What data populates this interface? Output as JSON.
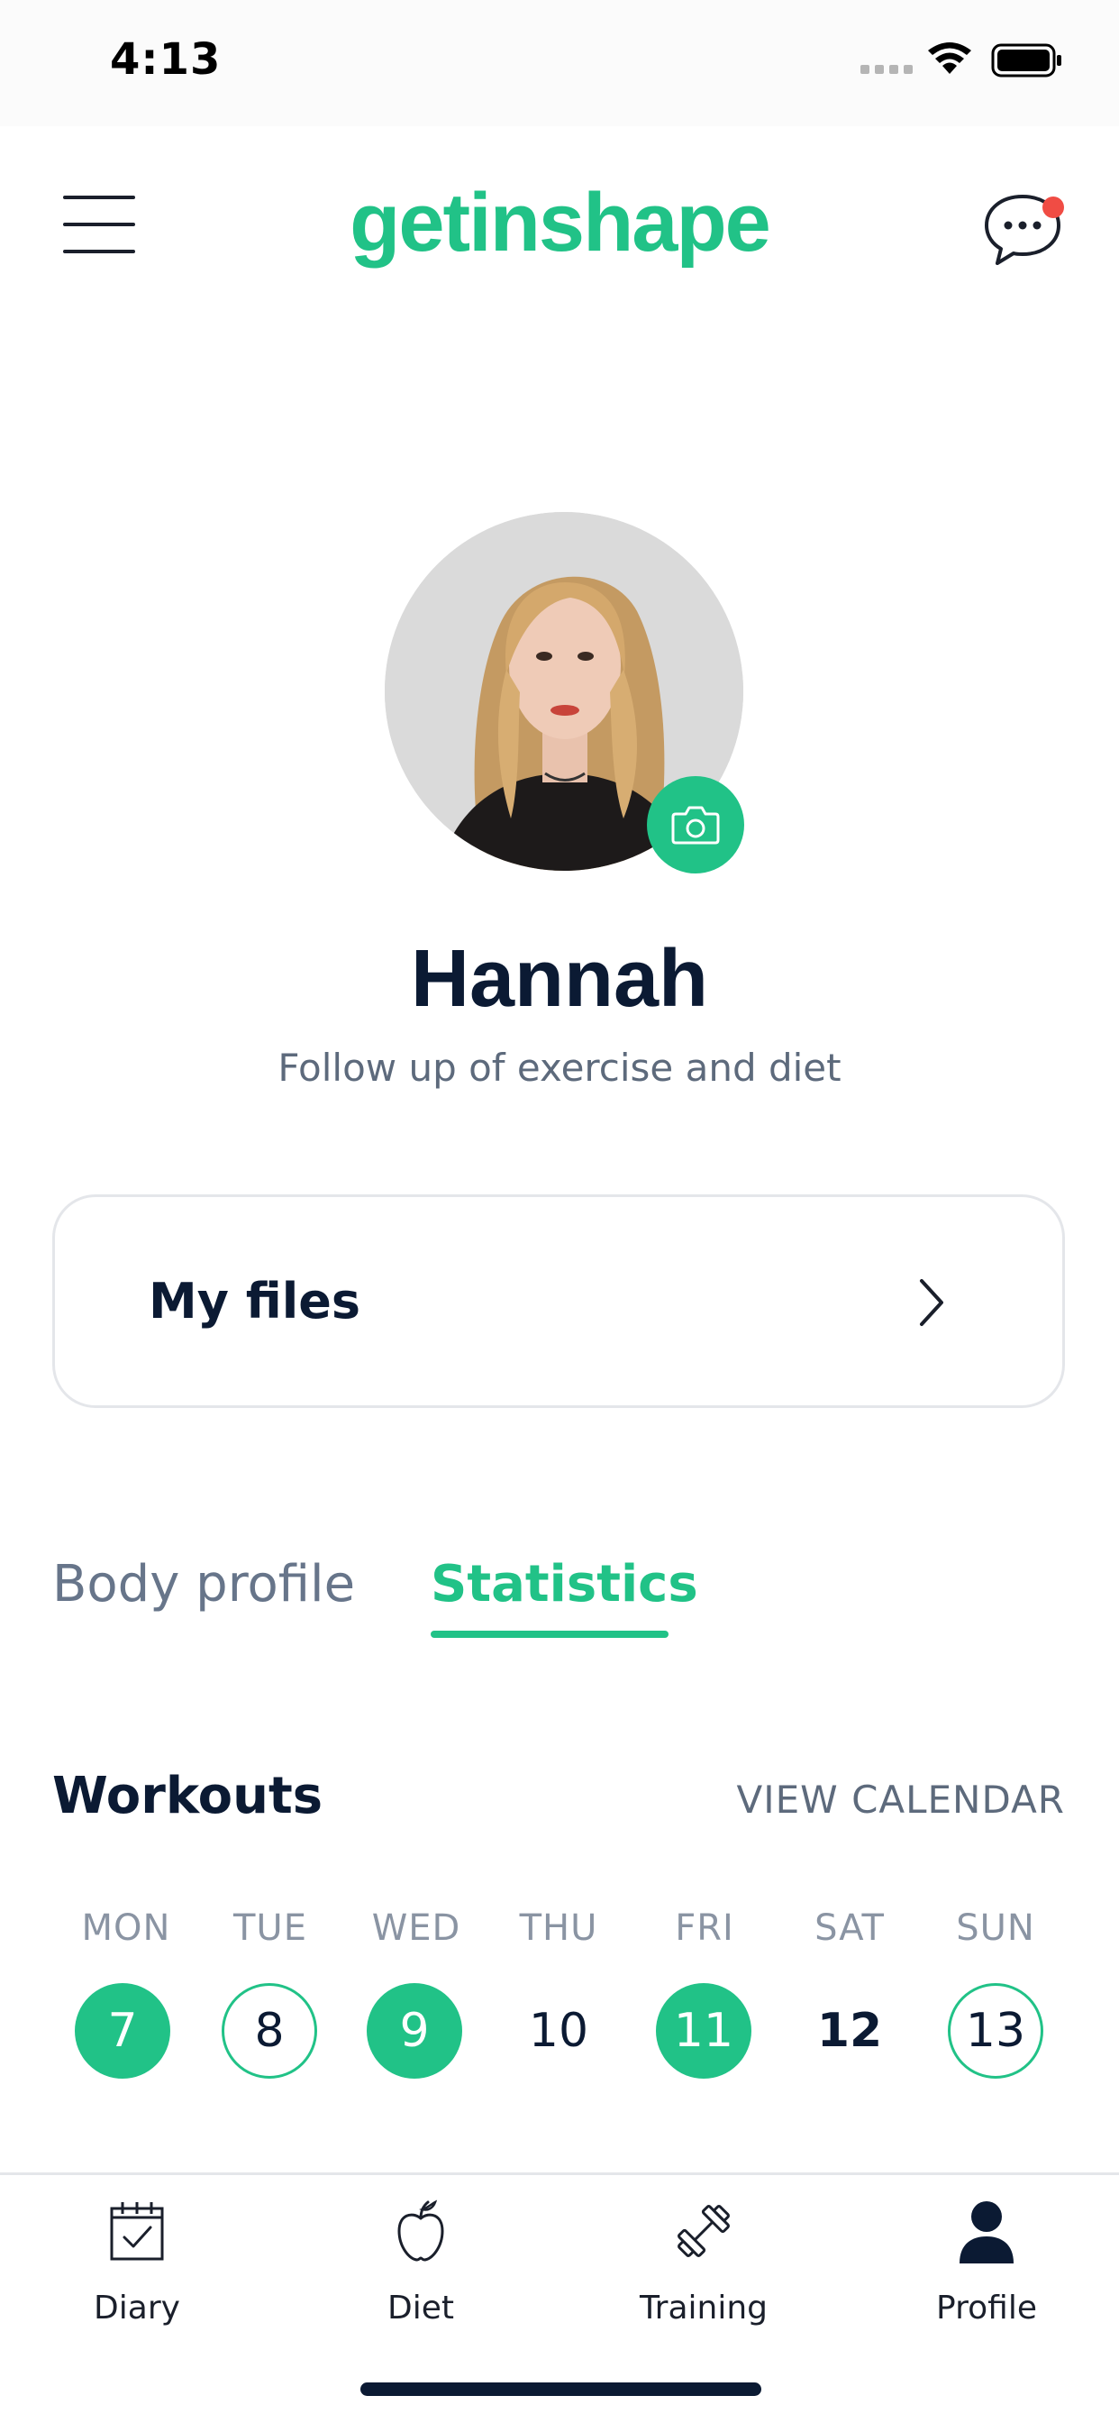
{
  "status_bar": {
    "time": "4:13"
  },
  "header": {
    "logo": "getinshape",
    "menu_icon": "hamburger-menu-icon",
    "chat_icon": "chat-bubble-icon",
    "brand_color": "#21c287"
  },
  "profile": {
    "name": "Hannah",
    "subtitle": "Follow up of exercise and diet",
    "camera_icon": "camera-icon"
  },
  "files_card": {
    "label": "My files"
  },
  "tabs": [
    {
      "label": "Body profile",
      "active": false
    },
    {
      "label": "Statistics",
      "active": true
    }
  ],
  "workouts": {
    "title": "Workouts",
    "view_calendar": "VIEW CALENDAR",
    "days": [
      {
        "name": "MON",
        "date": "7",
        "state": "filled"
      },
      {
        "name": "TUE",
        "date": "8",
        "state": "outline"
      },
      {
        "name": "WED",
        "date": "9",
        "state": "filled"
      },
      {
        "name": "THU",
        "date": "10",
        "state": "plain"
      },
      {
        "name": "FRI",
        "date": "11",
        "state": "filled"
      },
      {
        "name": "SAT",
        "date": "12",
        "state": "bold"
      },
      {
        "name": "SUN",
        "date": "13",
        "state": "outline"
      }
    ]
  },
  "bottom_nav": [
    {
      "label": "Diary",
      "icon": "calendar-check-icon"
    },
    {
      "label": "Diet",
      "icon": "apple-icon"
    },
    {
      "label": "Training",
      "icon": "dumbbell-icon"
    },
    {
      "label": "Profile",
      "icon": "user-icon",
      "active": true
    }
  ]
}
